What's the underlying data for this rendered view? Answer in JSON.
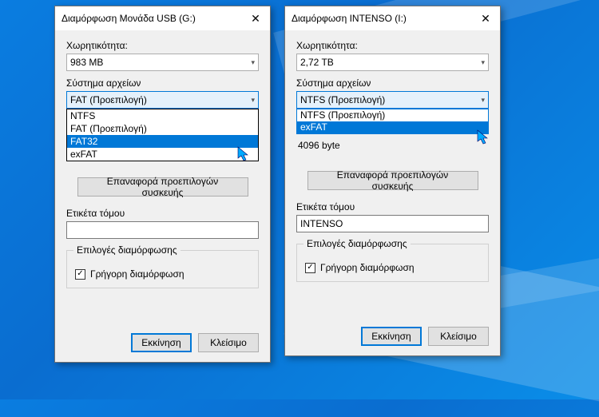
{
  "dialog_left": {
    "title": "Διαμόρφωση Μονάδα USB (G:)",
    "capacity_label": "Χωρητικότητα:",
    "capacity_value": "983 MB",
    "fs_label": "Σύστημα αρχείων",
    "fs_selected": "FAT  (Προεπιλογή)",
    "fs_options": [
      "NTFS",
      "FAT  (Προεπιλογή)",
      "FAT32",
      "exFAT"
    ],
    "fs_highlight_index": 2,
    "restore_defaults": "Επαναφορά προεπιλογών συσκευής",
    "volume_label": "Ετικέτα τόμου",
    "volume_value": "",
    "options_group": "Επιλογές διαμόρφωσης",
    "quick_format": "Γρήγορη διαμόρφωση",
    "quick_checked": true,
    "start": "Εκκίνηση",
    "close": "Κλείσιμο"
  },
  "dialog_right": {
    "title": "Διαμόρφωση INTENSO (I:)",
    "capacity_label": "Χωρητικότητα:",
    "capacity_value": "2,72 TB",
    "fs_label": "Σύστημα αρχείων",
    "fs_selected": "NTFS (Προεπιλογή)",
    "fs_options": [
      "NTFS  (Προεπιλογή)",
      "exFAT"
    ],
    "fs_highlight_index": 1,
    "alloc_value": "4096 byte",
    "restore_defaults": "Επαναφορά προεπιλογών συσκευής",
    "volume_label": "Ετικέτα τόμου",
    "volume_value": "INTENSO",
    "options_group": "Επιλογές διαμόρφωσης",
    "quick_format": "Γρήγορη διαμόρφωση",
    "quick_checked": true,
    "start": "Εκκίνηση",
    "close": "Κλείσιμο"
  }
}
